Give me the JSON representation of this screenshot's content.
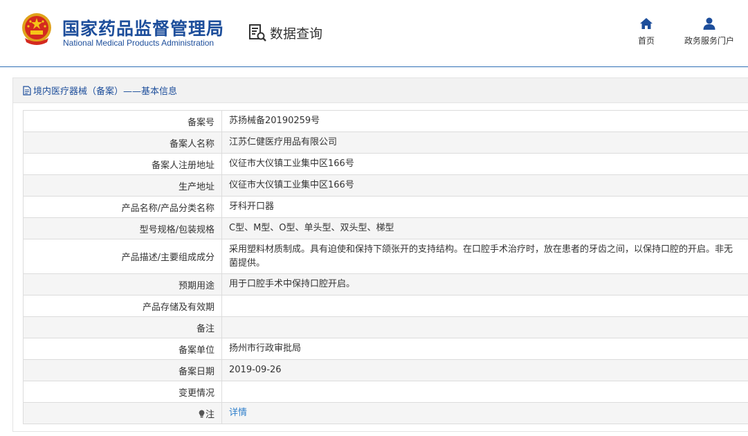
{
  "header": {
    "brand_cn": "国家药品监督管理局",
    "brand_en": "National Medical Products Administration",
    "query_label": "数据查询",
    "nav": [
      {
        "label": "首页",
        "icon": "home-icon"
      },
      {
        "label": "政务服务门户",
        "icon": "user-icon"
      }
    ]
  },
  "panel": {
    "title": "境内医疗器械（备案）——基本信息"
  },
  "rows": [
    {
      "label": "备案号",
      "value": "苏扬械备20190259号"
    },
    {
      "label": "备案人名称",
      "value": "江苏仁健医疗用品有限公司"
    },
    {
      "label": "备案人注册地址",
      "value": "仪征市大仪镇工业集中区166号"
    },
    {
      "label": "生产地址",
      "value": "仪征市大仪镇工业集中区166号"
    },
    {
      "label": "产品名称/产品分类名称",
      "value": "牙科开口器"
    },
    {
      "label": "型号规格/包装规格",
      "value": "C型、M型、O型、单头型、双头型、梯型"
    },
    {
      "label": "产品描述/主要组成成分",
      "value": "采用塑料材质制成。具有迫使和保持下颌张开的支持结构。在口腔手术治疗时，放在患者的牙齿之间，以保持口腔的开启。非无菌提供。"
    },
    {
      "label": "预期用途",
      "value": "用于口腔手术中保持口腔开启。"
    },
    {
      "label": "产品存储及有效期",
      "value": ""
    },
    {
      "label": "备注",
      "value": ""
    },
    {
      "label": "备案单位",
      "value": "扬州市行政审批局"
    },
    {
      "label": "备案日期",
      "value": "2019-09-26"
    },
    {
      "label": "变更情况",
      "value": ""
    },
    {
      "label": "注",
      "value": "详情",
      "icon": "bulb-icon"
    }
  ],
  "colors": {
    "brand": "#1d4e9b",
    "link": "#2f7fcb",
    "row_alt": "#f5f5f5"
  }
}
